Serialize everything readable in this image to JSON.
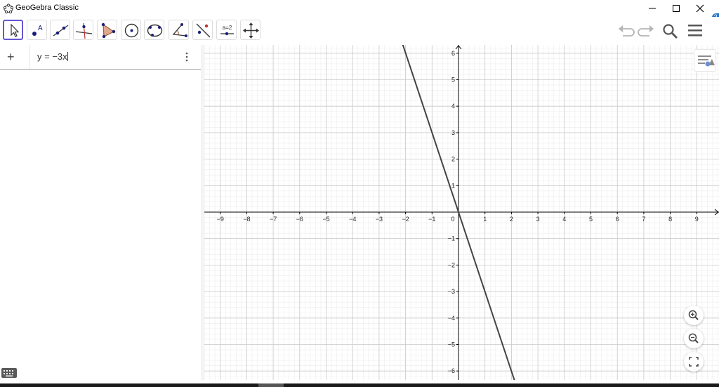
{
  "window": {
    "title": "GeoGebra Classic",
    "app_icon": "geogebra-logo-icon",
    "controls": [
      "minimize-icon",
      "maximize-icon",
      "close-icon"
    ]
  },
  "toolbar": {
    "tools": [
      {
        "name": "move-tool",
        "icon": "arrow-cursor-icon",
        "selected": true
      },
      {
        "name": "point-tool",
        "icon": "point-icon"
      },
      {
        "name": "line-tool",
        "icon": "line-icon"
      },
      {
        "name": "perpendicular-line-tool",
        "icon": "perpendicular-icon"
      },
      {
        "name": "polygon-tool",
        "icon": "polygon-icon"
      },
      {
        "name": "circle-tool",
        "icon": "circle-center-icon"
      },
      {
        "name": "conic-tool",
        "icon": "ellipse-icon"
      },
      {
        "name": "angle-tool",
        "icon": "angle-icon"
      },
      {
        "name": "reflect-tool",
        "icon": "reflect-icon"
      },
      {
        "name": "slider-tool",
        "icon": "slider-icon",
        "label": "a=2"
      },
      {
        "name": "move-graphics-tool",
        "icon": "move-arrows-icon"
      }
    ],
    "right": [
      "undo-icon",
      "redo-icon",
      "search-icon",
      "menu-icon"
    ]
  },
  "algebra": {
    "add_symbol": "+",
    "input_value": "y = −3x",
    "more_icon": "kebab-menu-icon"
  },
  "help_badge": "?",
  "graph": {
    "x_range": [
      -9.6,
      9.8
    ],
    "y_range": [
      -6.4,
      6.4
    ],
    "x_ticks": [
      "−9",
      "−8",
      "−7",
      "−6",
      "−5",
      "−4",
      "−3",
      "−2",
      "−1",
      "0",
      "1",
      "2",
      "3",
      "4",
      "5",
      "6",
      "7",
      "8",
      "9"
    ],
    "y_ticks_pos": [
      "1",
      "2",
      "3",
      "4",
      "5",
      "6"
    ],
    "y_ticks_neg": [
      "−1",
      "−2",
      "−3",
      "−4",
      "−5",
      "−6"
    ],
    "grid": true,
    "function": "y = −3x",
    "line_color": "#444444",
    "axis_color": "#000000",
    "major_grid_color": "#c8c8c8",
    "minor_grid_color": "#ececec"
  },
  "chart_data": {
    "type": "line",
    "title": "",
    "xlabel": "",
    "ylabel": "",
    "xlim": [
      -9.6,
      9.8
    ],
    "ylim": [
      -6.4,
      6.4
    ],
    "series": [
      {
        "name": "",
        "x": [
          -2.13,
          2.13
        ],
        "y": [
          6.4,
          -6.4
        ]
      }
    ]
  }
}
